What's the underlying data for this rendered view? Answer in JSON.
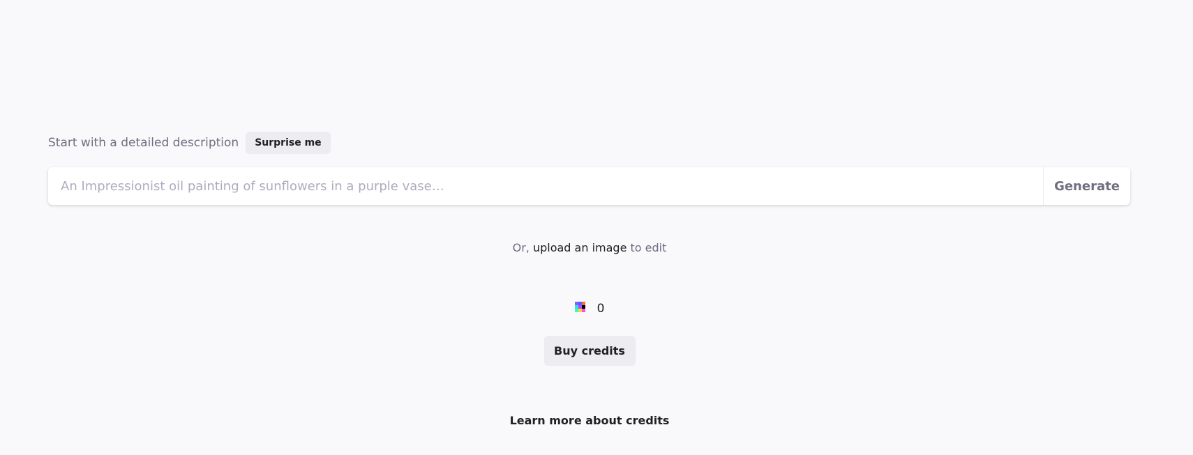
{
  "prompt_section": {
    "description_label": "Start with a detailed description",
    "surprise_label": "Surprise me",
    "input_placeholder": "An Impressionist oil painting of sunflowers in a purple vase…",
    "input_value": "",
    "generate_label": "Generate"
  },
  "upload": {
    "prefix": "Or, ",
    "link_text": "upload an image",
    "suffix": " to edit"
  },
  "credits": {
    "icon": "credits-pixel-icon",
    "count": "0",
    "buy_label": "Buy credits",
    "learn_more_label": "Learn more about credits"
  },
  "colors": {
    "background": "#f9f9fb",
    "button_bg": "#ececf1",
    "text_primary": "#202123",
    "text_secondary": "#6e6e80",
    "placeholder": "#acacbe",
    "credit_icon_pixels": [
      "#7b61ff",
      "#5b5bff",
      "#ff6b3d",
      "#f9f9fb",
      "#3dd6ff",
      "#a64dff",
      "#000000",
      "#f9f9fb",
      "#3dff9e",
      "#ffd23d",
      "#ff4de1",
      "#f9f9fb",
      "#f9f9fb",
      "#f9f9fb",
      "#f9f9fb",
      "#f9f9fb"
    ]
  }
}
